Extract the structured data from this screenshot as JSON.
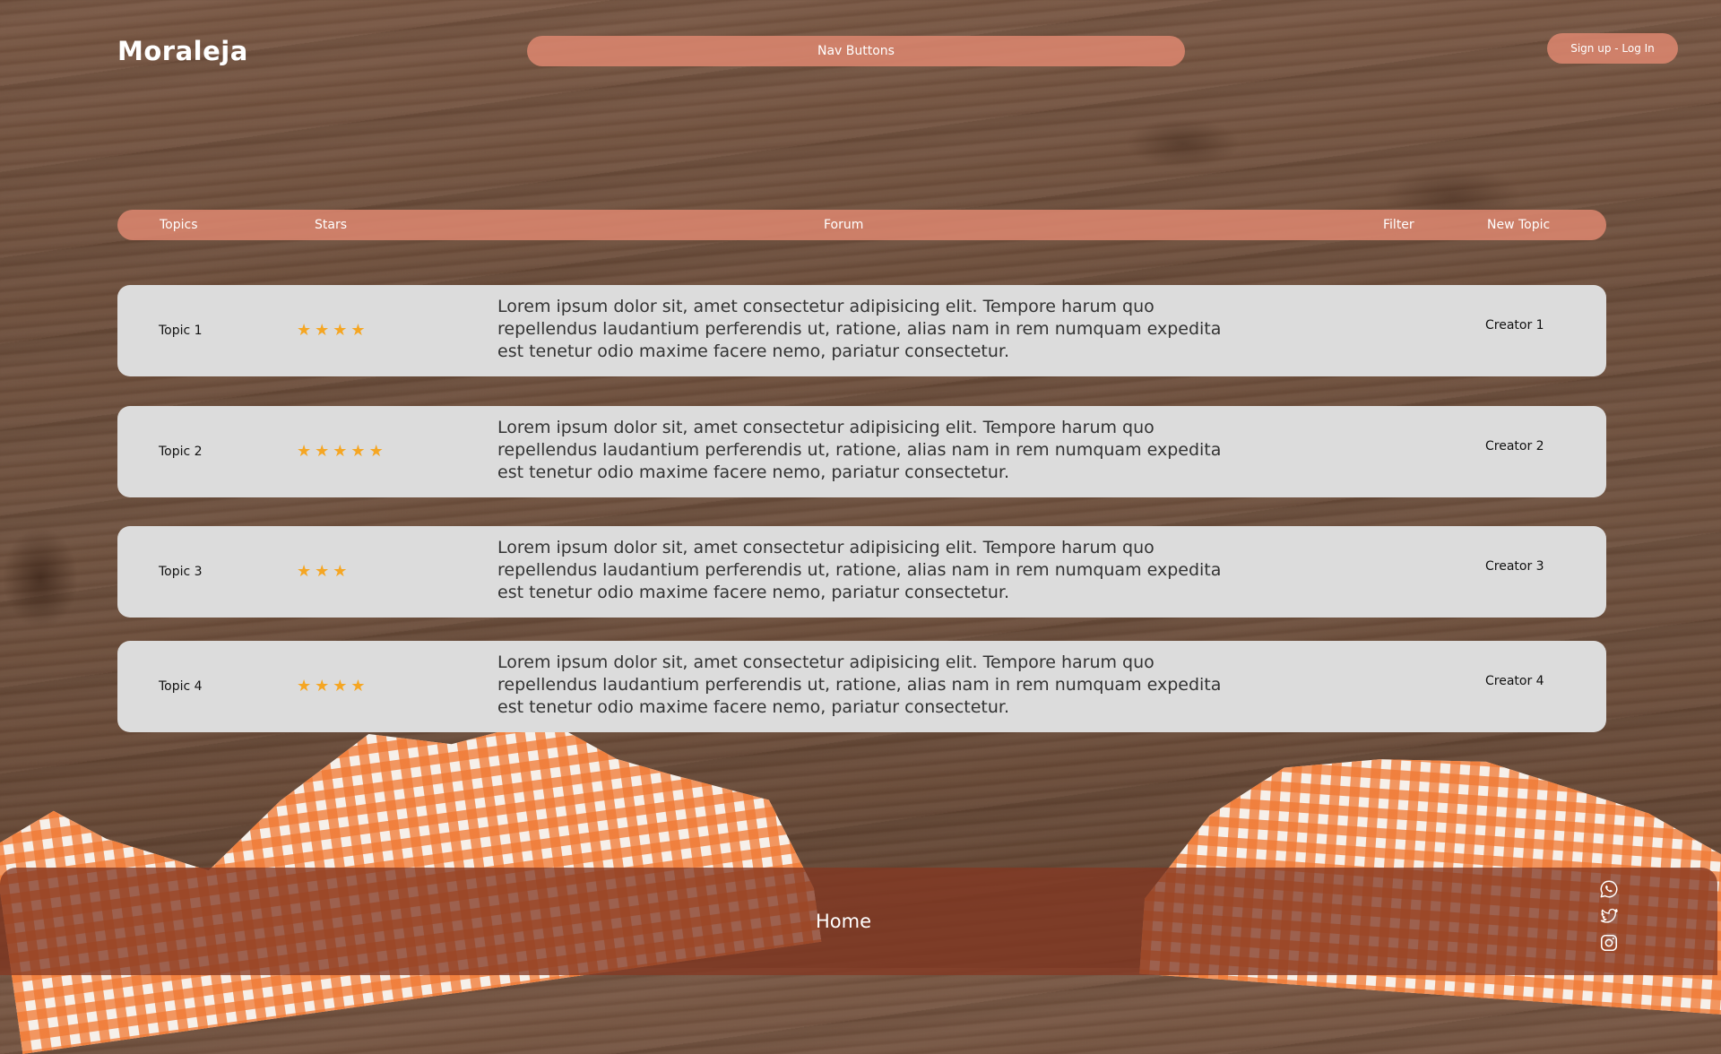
{
  "header": {
    "logo": "Moraleja",
    "nav_label": "Nav Buttons",
    "auth_label": "Sign up - Log In"
  },
  "forum_bar": {
    "topics": "Topics",
    "stars": "Stars",
    "forum": "Forum",
    "filter": "Filter",
    "new_topic": "New Topic"
  },
  "rows": [
    {
      "topic": "Topic 1",
      "stars": 4,
      "description": "Lorem ipsum dolor sit, amet consectetur adipisicing elit. Tempore harum quo repellendus laudantium perferendis ut, ratione, alias nam in rem numquam expedita est tenetur odio maxime facere nemo, pariatur consectetur.",
      "creator": "Creator 1"
    },
    {
      "topic": "Topic 2",
      "stars": 5,
      "description": "Lorem ipsum dolor sit, amet consectetur adipisicing elit. Tempore harum quo repellendus laudantium perferendis ut, ratione, alias nam in rem numquam expedita est tenetur odio maxime facere nemo, pariatur consectetur.",
      "creator": "Creator 2"
    },
    {
      "topic": "Topic 3",
      "stars": 3,
      "description": "Lorem ipsum dolor sit, amet consectetur adipisicing elit. Tempore harum quo repellendus laudantium perferendis ut, ratione, alias nam in rem numquam expedita est tenetur odio maxime facere nemo, pariatur consectetur.",
      "creator": "Creator 3"
    },
    {
      "topic": "Topic 4",
      "stars": 4,
      "description": "Lorem ipsum dolor sit, amet consectetur adipisicing elit. Tempore harum quo repellendus laudantium perferendis ut, ratione, alias nam in rem numquam expedita est tenetur odio maxime facere nemo, pariatur consectetur.",
      "creator": "Creator 4"
    }
  ],
  "footer": {
    "home_label": "Home",
    "social_icons": [
      "whatsapp-icon",
      "twitter-icon",
      "instagram-icon"
    ]
  },
  "colors": {
    "accent_pill": "#de8770",
    "star": "#f5a623",
    "row_bg": "#dcdcdc",
    "footer_bg": "#843822"
  }
}
